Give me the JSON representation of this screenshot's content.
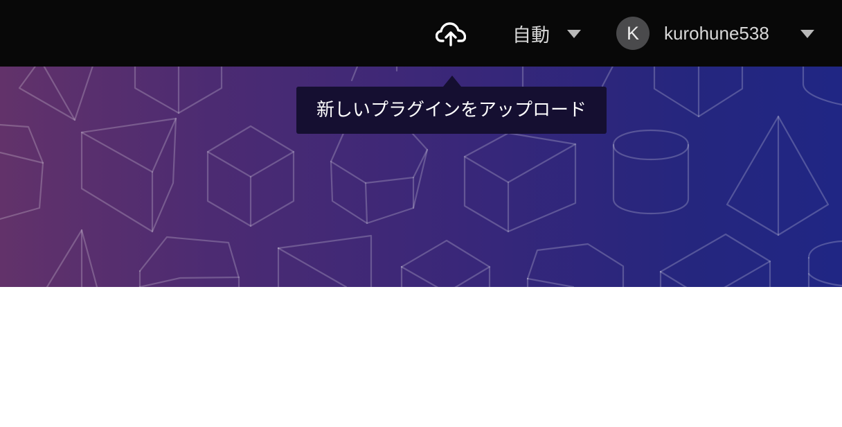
{
  "topbar": {
    "upload_icon": "cloud-upload-icon",
    "language": {
      "selected": "自動",
      "dropdown_icon": "chevron-down-icon"
    },
    "user": {
      "avatar_initial": "K",
      "username": "kurohune538",
      "dropdown_icon": "chevron-down-icon"
    }
  },
  "tooltip": {
    "text": "新しいプラグインをアップロード"
  },
  "banner": {
    "pattern": "geometric-shapes",
    "gradient_start": "#62326A",
    "gradient_end": "#202684"
  },
  "colors": {
    "topbar_background": "#080808",
    "text_primary": "#D8D8D8",
    "tooltip_background": "#150F31"
  }
}
